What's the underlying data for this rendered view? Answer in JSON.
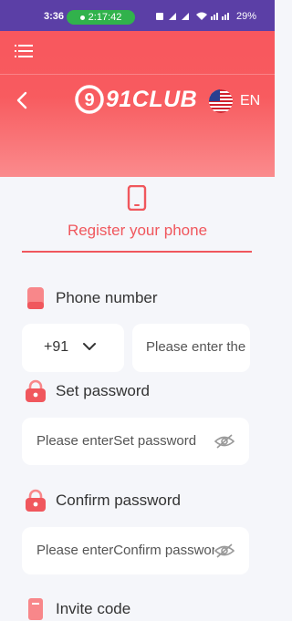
{
  "status_bar": {
    "time": "3:36",
    "call_timer": "2:17:42",
    "indicators": "❆ ൞ ൞ ໭ Vo) ⸫ ⸫",
    "battery": "29%"
  },
  "header": {
    "logo_text": "91CLUB",
    "logo_digit": "9",
    "language": "EN",
    "brand_color": "#f8575e"
  },
  "tab": {
    "label": "Register your phone",
    "accent_color": "#f0575d"
  },
  "form": {
    "phone": {
      "label": "Phone number",
      "country_code": "+91",
      "placeholder": "Please enter the phone number"
    },
    "password": {
      "label": "Set password",
      "placeholder": "Please enterSet password"
    },
    "confirm_password": {
      "label": "Confirm password",
      "placeholder": "Please enterConfirm password"
    },
    "invite": {
      "label": "Invite code"
    }
  }
}
